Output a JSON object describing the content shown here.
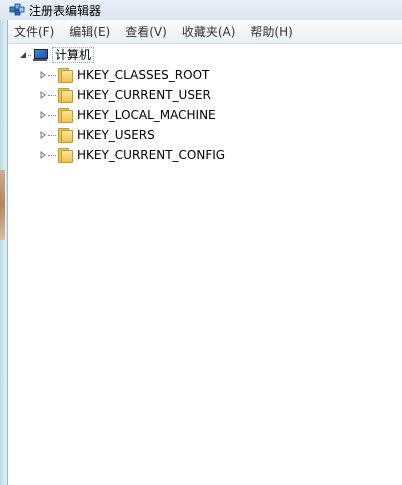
{
  "window": {
    "title": "注册表编辑器",
    "title_icon": "registry-editor-icon"
  },
  "menu": {
    "items": [
      {
        "label": "文件(F)"
      },
      {
        "label": "编辑(E)"
      },
      {
        "label": "查看(V)"
      },
      {
        "label": "收藏夹(A)"
      },
      {
        "label": "帮助(H)"
      }
    ]
  },
  "tree": {
    "root": {
      "label": "计算机",
      "icon": "computer-icon",
      "expanded": true
    },
    "keys": [
      {
        "label": "HKEY_CLASSES_ROOT",
        "icon": "folder-icon"
      },
      {
        "label": "HKEY_CURRENT_USER",
        "icon": "folder-icon"
      },
      {
        "label": "HKEY_LOCAL_MACHINE",
        "icon": "folder-icon"
      },
      {
        "label": "HKEY_USERS",
        "icon": "folder-icon"
      },
      {
        "label": "HKEY_CURRENT_CONFIG",
        "icon": "folder-icon"
      }
    ]
  },
  "colors": {
    "titlebar": "#dce6f1",
    "menubar": "#e9eef6",
    "folder": "#f0c552"
  }
}
